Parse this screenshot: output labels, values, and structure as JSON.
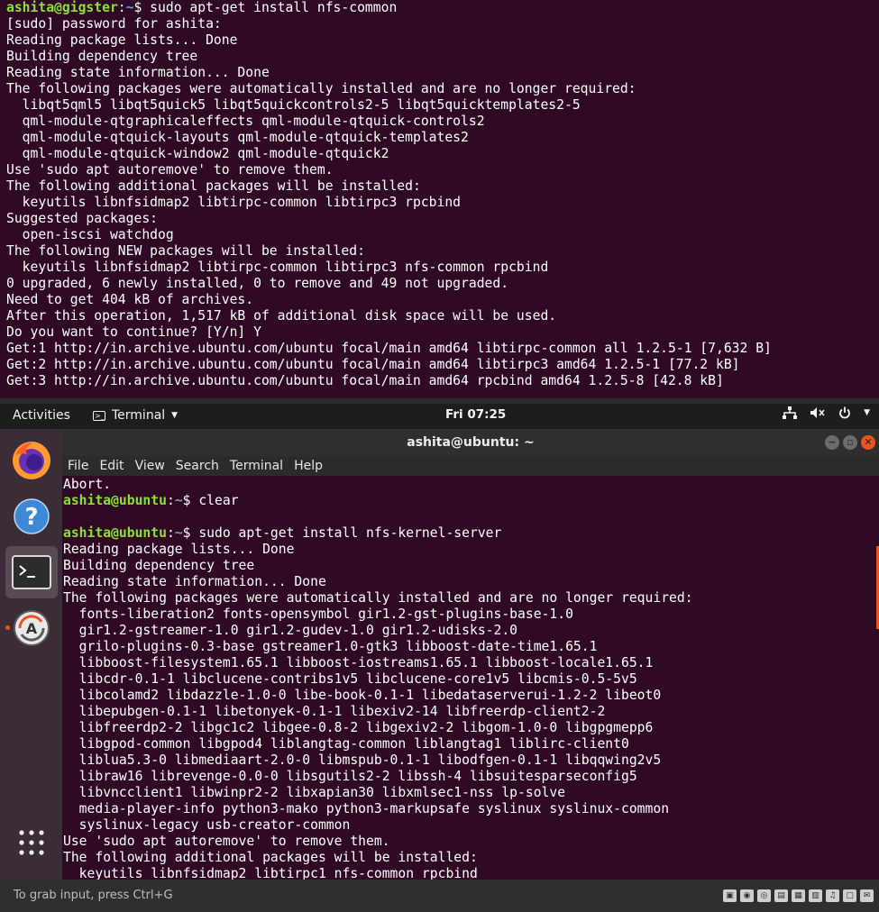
{
  "host_terminal": {
    "prompt": {
      "user": "ashita@gigster",
      "path": "~",
      "symbol": "$",
      "command": "sudo apt-get install nfs-common"
    },
    "lines": [
      "[sudo] password for ashita:",
      "Reading package lists... Done",
      "Building dependency tree",
      "Reading state information... Done",
      "The following packages were automatically installed and are no longer required:",
      "  libqt5qml5 libqt5quick5 libqt5quickcontrols2-5 libqt5quicktemplates2-5",
      "  qml-module-qtgraphicaleffects qml-module-qtquick-controls2",
      "  qml-module-qtquick-layouts qml-module-qtquick-templates2",
      "  qml-module-qtquick-window2 qml-module-qtquick2",
      "Use 'sudo apt autoremove' to remove them.",
      "The following additional packages will be installed:",
      "  keyutils libnfsidmap2 libtirpc-common libtirpc3 rpcbind",
      "Suggested packages:",
      "  open-iscsi watchdog",
      "The following NEW packages will be installed:",
      "  keyutils libnfsidmap2 libtirpc-common libtirpc3 nfs-common rpcbind",
      "0 upgraded, 6 newly installed, 0 to remove and 49 not upgraded.",
      "Need to get 404 kB of archives.",
      "After this operation, 1,517 kB of additional disk space will be used.",
      "Do you want to continue? [Y/n] Y",
      "Get:1 http://in.archive.ubuntu.com/ubuntu focal/main amd64 libtirpc-common all 1.2.5-1 [7,632 B]",
      "Get:2 http://in.archive.ubuntu.com/ubuntu focal/main amd64 libtirpc3 amd64 1.2.5-1 [77.2 kB]",
      "Get:3 http://in.archive.ubuntu.com/ubuntu focal/main amd64 rpcbind amd64 1.2.5-8 [42.8 kB]"
    ]
  },
  "topbar": {
    "activities": "Activities",
    "app_name": "Terminal",
    "clock": "Fri 07:25",
    "status_icons": [
      "network-icon",
      "volume-muted-icon",
      "power-icon"
    ]
  },
  "dock": {
    "items": [
      "firefox-icon",
      "help-icon",
      "terminal-icon",
      "software-updater-icon",
      "show-apps-icon"
    ]
  },
  "vm_window": {
    "title": "ashita@ubuntu: ~",
    "menu": [
      "File",
      "Edit",
      "View",
      "Search",
      "Terminal",
      "Help"
    ],
    "lines": [
      {
        "text": "Abort."
      },
      {
        "user": "ashita@ubuntu",
        "path": "~",
        "symbol": "$",
        "command": "clear"
      },
      {
        "text": ""
      },
      {
        "user": "ashita@ubuntu",
        "path": "~",
        "symbol": "$",
        "command": "sudo apt-get install nfs-kernel-server"
      },
      {
        "text": "Reading package lists... Done"
      },
      {
        "text": "Building dependency tree"
      },
      {
        "text": "Reading state information... Done"
      },
      {
        "text": "The following packages were automatically installed and are no longer required:"
      },
      {
        "text": "  fonts-liberation2 fonts-opensymbol gir1.2-gst-plugins-base-1.0"
      },
      {
        "text": "  gir1.2-gstreamer-1.0 gir1.2-gudev-1.0 gir1.2-udisks-2.0"
      },
      {
        "text": "  grilo-plugins-0.3-base gstreamer1.0-gtk3 libboost-date-time1.65.1"
      },
      {
        "text": "  libboost-filesystem1.65.1 libboost-iostreams1.65.1 libboost-locale1.65.1"
      },
      {
        "text": "  libcdr-0.1-1 libclucene-contribs1v5 libclucene-core1v5 libcmis-0.5-5v5"
      },
      {
        "text": "  libcolamd2 libdazzle-1.0-0 libe-book-0.1-1 libedataserverui-1.2-2 libeot0"
      },
      {
        "text": "  libepubgen-0.1-1 libetonyek-0.1-1 libexiv2-14 libfreerdp-client2-2"
      },
      {
        "text": "  libfreerdp2-2 libgc1c2 libgee-0.8-2 libgexiv2-2 libgom-1.0-0 libgpgmepp6"
      },
      {
        "text": "  libgpod-common libgpod4 liblangtag-common liblangtag1 liblirc-client0"
      },
      {
        "text": "  liblua5.3-0 libmediaart-2.0-0 libmspub-0.1-1 libodfgen-0.1-1 libqqwing2v5"
      },
      {
        "text": "  libraw16 librevenge-0.0-0 libsgutils2-2 libssh-4 libsuitesparseconfig5"
      },
      {
        "text": "  libvncclient1 libwinpr2-2 libxapian30 libxmlsec1-nss lp-solve"
      },
      {
        "text": "  media-player-info python3-mako python3-markupsafe syslinux syslinux-common"
      },
      {
        "text": "  syslinux-legacy usb-creator-common"
      },
      {
        "text": "Use 'sudo apt autoremove' to remove them."
      },
      {
        "text": "The following additional packages will be installed:"
      },
      {
        "text": "  keyutils libnfsidmap2 libtirpc1 nfs-common rpcbind"
      }
    ]
  },
  "statusbar": {
    "hint": "To grab input, press Ctrl+G",
    "icons": [
      "hdd-icon",
      "cd-icon",
      "cd2-icon",
      "floppy-icon",
      "network-adapter-icon",
      "printer-icon",
      "audio-icon",
      "display-disabled-icon",
      "message-icon"
    ]
  },
  "colors": {
    "terminal_bg": "#300a24",
    "prompt_user": "#8ae234",
    "prompt_path": "#729fcf",
    "accent": "#e95420"
  }
}
